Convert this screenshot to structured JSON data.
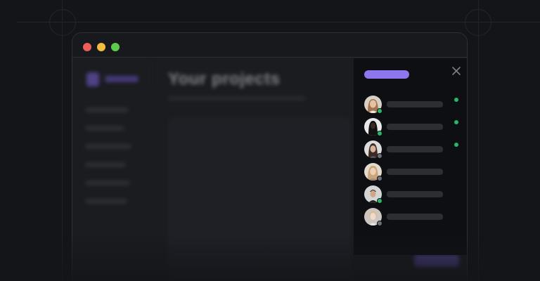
{
  "window": {
    "controls": {
      "close_color": "#ee5f57",
      "minimize_color": "#f5bd3d",
      "maximize_color": "#5fca4b"
    }
  },
  "background_app": {
    "page_title": "Your projects",
    "accent_color": "#7d62d9"
  },
  "users_panel": {
    "accent_color": "#8e76ee",
    "close_icon": "close-icon",
    "users": [
      {
        "avatar": "avatar-woman-long-hair",
        "status": "online",
        "presence_dot": true
      },
      {
        "avatar": "avatar-person-dark-hood",
        "status": "online",
        "presence_dot": true
      },
      {
        "avatar": "avatar-woman-dark-hair",
        "status": "offline",
        "presence_dot": true
      },
      {
        "avatar": "avatar-woman-blonde",
        "status": "offline",
        "presence_dot": false
      },
      {
        "avatar": "avatar-man-short-hair",
        "status": "online",
        "presence_dot": false
      },
      {
        "avatar": "avatar-person-light",
        "status": "offline",
        "presence_dot": false
      }
    ],
    "status_colors": {
      "online": "#27b768",
      "offline": "#6d7078"
    }
  }
}
